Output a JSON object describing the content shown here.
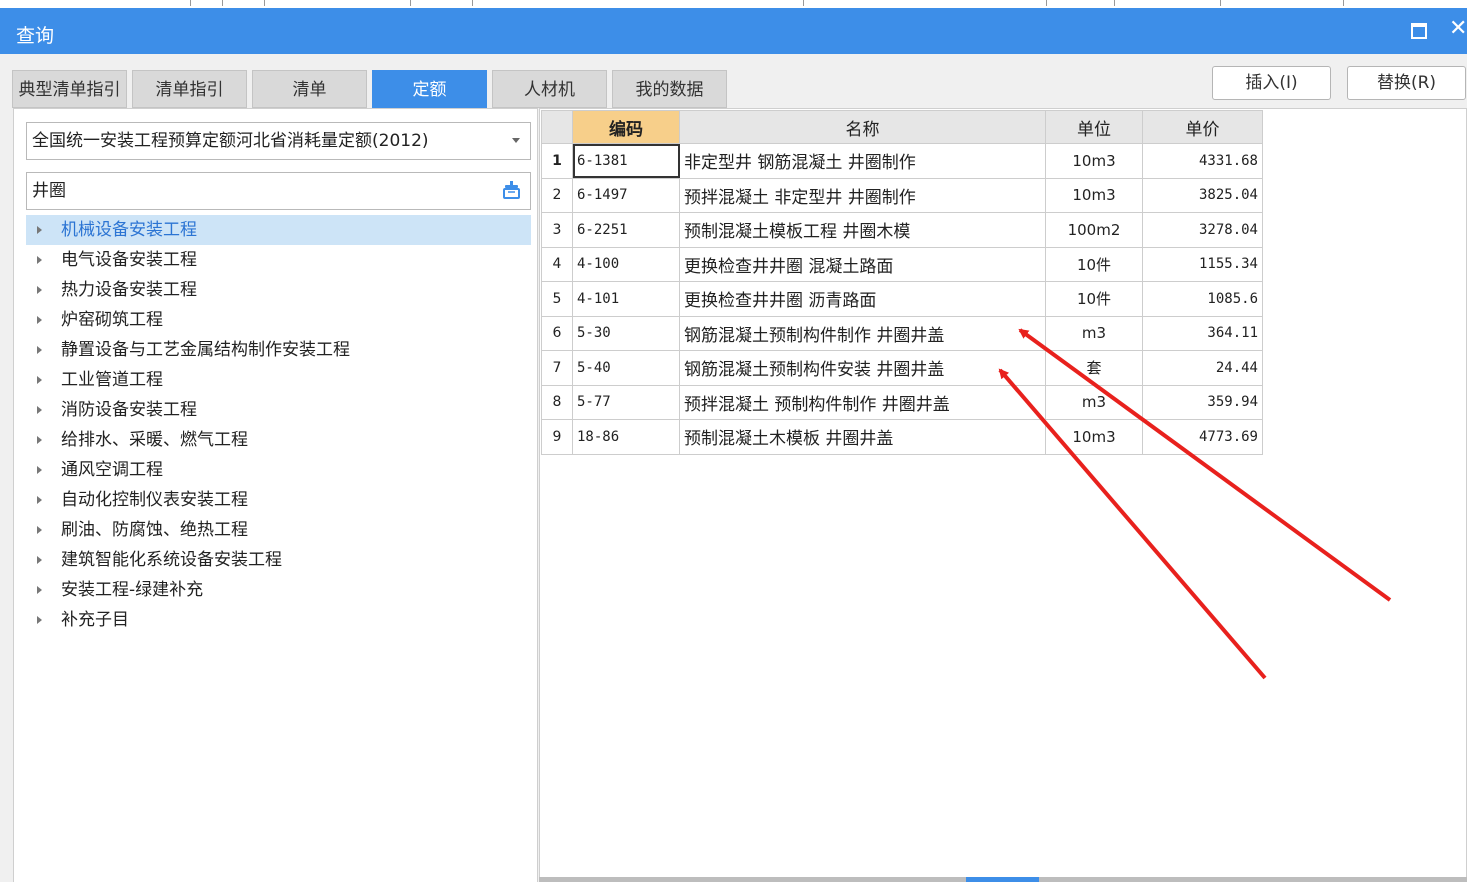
{
  "window": {
    "title": "查询"
  },
  "colors": {
    "accent": "#3d8ee8",
    "selected_header": "#f7cf8a",
    "arrow": "#e8211d"
  },
  "tabs": [
    {
      "label": "典型清单指引"
    },
    {
      "label": "清单指引"
    },
    {
      "label": "清单"
    },
    {
      "label": "定额"
    },
    {
      "label": "人材机"
    },
    {
      "label": "我的数据"
    }
  ],
  "actions": {
    "insert_label": "插入(I)",
    "replace_label": "替换(R)"
  },
  "left": {
    "quota_library": "全国统一安装工程预算定额河北省消耗量定额(2012)",
    "search_value": "井圈",
    "tree": [
      "机械设备安装工程",
      "电气设备安装工程",
      "热力设备安装工程",
      "炉窑砌筑工程",
      "静置设备与工艺金属结构制作安装工程",
      "工业管道工程",
      "消防设备安装工程",
      "给排水、采暖、燃气工程",
      "通风空调工程",
      "自动化控制仪表安装工程",
      "刷油、防腐蚀、绝热工程",
      "建筑智能化系统设备安装工程",
      "安装工程-绿建补充",
      "补充子目"
    ]
  },
  "table": {
    "columns": {
      "code": "编码",
      "name": "名称",
      "unit": "单位",
      "price": "单价"
    },
    "rows": [
      {
        "no": "1",
        "code": "6-1381",
        "name": "非定型井 钢筋混凝土 井圈制作",
        "unit": "10m3",
        "price": "4331.68"
      },
      {
        "no": "2",
        "code": "6-1497",
        "name": "预拌混凝土 非定型井 井圈制作",
        "unit": "10m3",
        "price": "3825.04"
      },
      {
        "no": "3",
        "code": "6-2251",
        "name": "预制混凝土模板工程 井圈木模",
        "unit": "100m2",
        "price": "3278.04"
      },
      {
        "no": "4",
        "code": "4-100",
        "name": "更换检查井井圈 混凝土路面",
        "unit": "10件",
        "price": "1155.34"
      },
      {
        "no": "5",
        "code": "4-101",
        "name": "更换检查井井圈 沥青路面",
        "unit": "10件",
        "price": "1085.6"
      },
      {
        "no": "6",
        "code": "5-30",
        "name": "钢筋混凝土预制构件制作 井圈井盖",
        "unit": "m3",
        "price": "364.11"
      },
      {
        "no": "7",
        "code": "5-40",
        "name": "钢筋混凝土预制构件安装 井圈井盖",
        "unit": "套",
        "price": "24.44"
      },
      {
        "no": "8",
        "code": "5-77",
        "name": "预拌混凝土 预制构件制作 井圈井盖",
        "unit": "m3",
        "price": "359.94"
      },
      {
        "no": "9",
        "code": "18-86",
        "name": "预制混凝土木模板 井圈井盖",
        "unit": "10m3",
        "price": "4773.69"
      }
    ]
  }
}
